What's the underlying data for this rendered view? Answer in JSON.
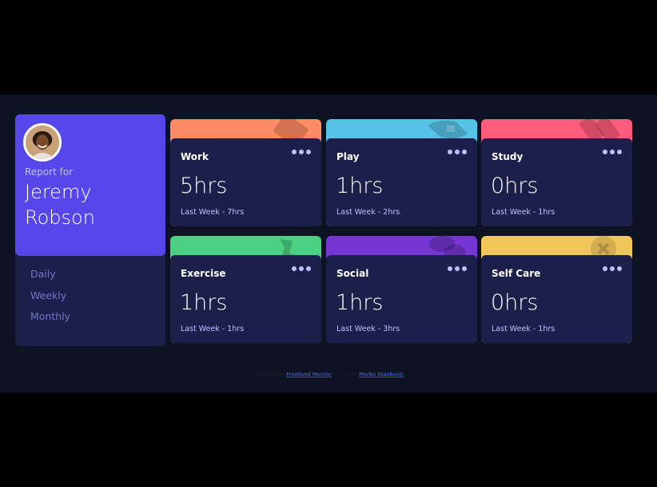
{
  "profile": {
    "report_label": "Report for",
    "name": "Jeremy Robson",
    "avatar_icon": "person-avatar-icon",
    "accent": "#5747ea"
  },
  "timeframes": [
    "Daily",
    "Weekly",
    "Monthly"
  ],
  "cards": [
    {
      "title": "Work",
      "hours": "5hrs",
      "previous": "Last Week - 7hrs",
      "color": "#ff8c66",
      "icon": "briefcase-icon"
    },
    {
      "title": "Play",
      "hours": "1hrs",
      "previous": "Last Week - 2hrs",
      "color": "#56c2e6",
      "icon": "game-controller-icon"
    },
    {
      "title": "Study",
      "hours": "0hrs",
      "previous": "Last Week - 1hrs",
      "color": "#ff5c7c",
      "icon": "books-icon"
    },
    {
      "title": "Exercise",
      "hours": "1hrs",
      "previous": "Last Week - 1hrs",
      "color": "#4bcf82",
      "icon": "running-icon"
    },
    {
      "title": "Social",
      "hours": "1hrs",
      "previous": "Last Week - 3hrs",
      "color": "#7536d3",
      "icon": "chat-icon"
    },
    {
      "title": "Self Care",
      "hours": "0hrs",
      "previous": "Last Week - 1hrs",
      "color": "#f1c65b",
      "icon": "care-icon"
    }
  ],
  "footer": {
    "prefix": "Challenge by",
    "link1": "Frontend Mentor",
    "middle": ". Coded by",
    "link2": "Marko Stankovic"
  }
}
